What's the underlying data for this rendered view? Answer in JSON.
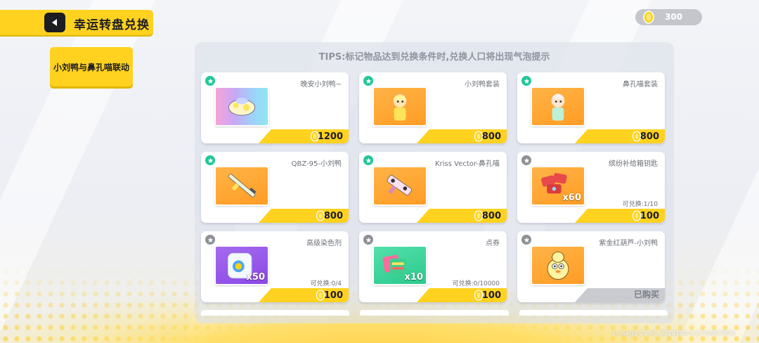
{
  "header": {
    "title": "幸运转盘兑换",
    "back_icon": "back-arrow-icon"
  },
  "currency": {
    "icon": "gold-coin-icon",
    "value": "300"
  },
  "sidebar": {
    "tab_label": "小刘鸭与鼻孔喵联动"
  },
  "panel": {
    "tips": "TIPS:标记物品达到兑换条件时,兑换人口将出现气泡提示"
  },
  "items": [
    {
      "name": "晚安小刘鸭~",
      "price": "1200",
      "marked": true,
      "thumb": "rainbow",
      "icon": "duck-plush-icon",
      "qty": "",
      "limit": ""
    },
    {
      "name": "小刘鸭套装",
      "price": "800",
      "marked": true,
      "thumb": "orange",
      "icon": "duck-outfit-icon",
      "qty": "",
      "limit": ""
    },
    {
      "name": "鼻孔喵套装",
      "price": "800",
      "marked": true,
      "thumb": "orange",
      "icon": "cat-outfit-icon",
      "qty": "",
      "limit": ""
    },
    {
      "name": "QBZ-95-小刘鸭",
      "price": "800",
      "marked": true,
      "thumb": "orange",
      "icon": "rifle-icon",
      "qty": "",
      "limit": ""
    },
    {
      "name": "Kriss Vector-鼻孔喵",
      "price": "800",
      "marked": true,
      "thumb": "orange",
      "icon": "smg-icon",
      "qty": "",
      "limit": ""
    },
    {
      "name": "缤纷补给箱钥匙",
      "price": "100",
      "marked": false,
      "thumb": "orange",
      "icon": "supply-key-icon",
      "qty": "x60",
      "limit": "可兑换:1/10"
    },
    {
      "name": "高级染色剂",
      "price": "100",
      "marked": false,
      "thumb": "purple",
      "icon": "dye-jar-icon",
      "qty": "x50",
      "limit": "可兑换:0/4"
    },
    {
      "name": "点券",
      "price": "100",
      "marked": false,
      "thumb": "green",
      "icon": "coupon-icon",
      "qty": "x10",
      "limit": "可兑换:0/10000"
    },
    {
      "name": "紫金红葫芦-小刘鸭",
      "price": "已购买",
      "marked": false,
      "purchased": true,
      "thumb": "orange",
      "icon": "gourd-duck-icon",
      "qty": "",
      "limit": ""
    }
  ],
  "footer": {
    "build_id": "1-esxg3-23.61.3324140-t:1774957593"
  },
  "colors": {
    "accent_yellow": "#ffd21f",
    "marked_green": "#22c79a",
    "unmarked_grey": "#8d9097",
    "dark": "#1c1d22"
  }
}
